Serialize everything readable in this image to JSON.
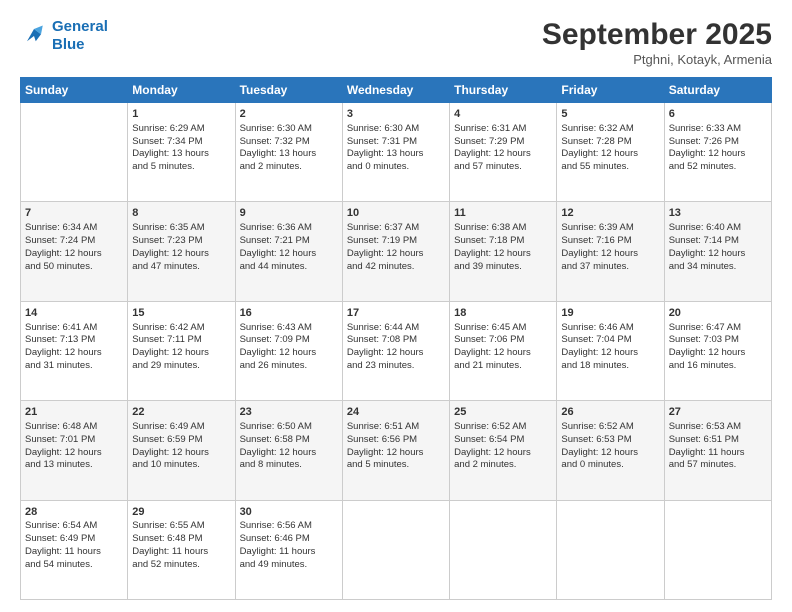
{
  "logo": {
    "line1": "General",
    "line2": "Blue"
  },
  "title": "September 2025",
  "subtitle": "Ptghni, Kotayk, Armenia",
  "headers": [
    "Sunday",
    "Monday",
    "Tuesday",
    "Wednesday",
    "Thursday",
    "Friday",
    "Saturday"
  ],
  "weeks": [
    [
      {
        "day": "",
        "info": ""
      },
      {
        "day": "1",
        "info": "Sunrise: 6:29 AM\nSunset: 7:34 PM\nDaylight: 13 hours\nand 5 minutes."
      },
      {
        "day": "2",
        "info": "Sunrise: 6:30 AM\nSunset: 7:32 PM\nDaylight: 13 hours\nand 2 minutes."
      },
      {
        "day": "3",
        "info": "Sunrise: 6:30 AM\nSunset: 7:31 PM\nDaylight: 13 hours\nand 0 minutes."
      },
      {
        "day": "4",
        "info": "Sunrise: 6:31 AM\nSunset: 7:29 PM\nDaylight: 12 hours\nand 57 minutes."
      },
      {
        "day": "5",
        "info": "Sunrise: 6:32 AM\nSunset: 7:28 PM\nDaylight: 12 hours\nand 55 minutes."
      },
      {
        "day": "6",
        "info": "Sunrise: 6:33 AM\nSunset: 7:26 PM\nDaylight: 12 hours\nand 52 minutes."
      }
    ],
    [
      {
        "day": "7",
        "info": "Sunrise: 6:34 AM\nSunset: 7:24 PM\nDaylight: 12 hours\nand 50 minutes."
      },
      {
        "day": "8",
        "info": "Sunrise: 6:35 AM\nSunset: 7:23 PM\nDaylight: 12 hours\nand 47 minutes."
      },
      {
        "day": "9",
        "info": "Sunrise: 6:36 AM\nSunset: 7:21 PM\nDaylight: 12 hours\nand 44 minutes."
      },
      {
        "day": "10",
        "info": "Sunrise: 6:37 AM\nSunset: 7:19 PM\nDaylight: 12 hours\nand 42 minutes."
      },
      {
        "day": "11",
        "info": "Sunrise: 6:38 AM\nSunset: 7:18 PM\nDaylight: 12 hours\nand 39 minutes."
      },
      {
        "day": "12",
        "info": "Sunrise: 6:39 AM\nSunset: 7:16 PM\nDaylight: 12 hours\nand 37 minutes."
      },
      {
        "day": "13",
        "info": "Sunrise: 6:40 AM\nSunset: 7:14 PM\nDaylight: 12 hours\nand 34 minutes."
      }
    ],
    [
      {
        "day": "14",
        "info": "Sunrise: 6:41 AM\nSunset: 7:13 PM\nDaylight: 12 hours\nand 31 minutes."
      },
      {
        "day": "15",
        "info": "Sunrise: 6:42 AM\nSunset: 7:11 PM\nDaylight: 12 hours\nand 29 minutes."
      },
      {
        "day": "16",
        "info": "Sunrise: 6:43 AM\nSunset: 7:09 PM\nDaylight: 12 hours\nand 26 minutes."
      },
      {
        "day": "17",
        "info": "Sunrise: 6:44 AM\nSunset: 7:08 PM\nDaylight: 12 hours\nand 23 minutes."
      },
      {
        "day": "18",
        "info": "Sunrise: 6:45 AM\nSunset: 7:06 PM\nDaylight: 12 hours\nand 21 minutes."
      },
      {
        "day": "19",
        "info": "Sunrise: 6:46 AM\nSunset: 7:04 PM\nDaylight: 12 hours\nand 18 minutes."
      },
      {
        "day": "20",
        "info": "Sunrise: 6:47 AM\nSunset: 7:03 PM\nDaylight: 12 hours\nand 16 minutes."
      }
    ],
    [
      {
        "day": "21",
        "info": "Sunrise: 6:48 AM\nSunset: 7:01 PM\nDaylight: 12 hours\nand 13 minutes."
      },
      {
        "day": "22",
        "info": "Sunrise: 6:49 AM\nSunset: 6:59 PM\nDaylight: 12 hours\nand 10 minutes."
      },
      {
        "day": "23",
        "info": "Sunrise: 6:50 AM\nSunset: 6:58 PM\nDaylight: 12 hours\nand 8 minutes."
      },
      {
        "day": "24",
        "info": "Sunrise: 6:51 AM\nSunset: 6:56 PM\nDaylight: 12 hours\nand 5 minutes."
      },
      {
        "day": "25",
        "info": "Sunrise: 6:52 AM\nSunset: 6:54 PM\nDaylight: 12 hours\nand 2 minutes."
      },
      {
        "day": "26",
        "info": "Sunrise: 6:52 AM\nSunset: 6:53 PM\nDaylight: 12 hours\nand 0 minutes."
      },
      {
        "day": "27",
        "info": "Sunrise: 6:53 AM\nSunset: 6:51 PM\nDaylight: 11 hours\nand 57 minutes."
      }
    ],
    [
      {
        "day": "28",
        "info": "Sunrise: 6:54 AM\nSunset: 6:49 PM\nDaylight: 11 hours\nand 54 minutes."
      },
      {
        "day": "29",
        "info": "Sunrise: 6:55 AM\nSunset: 6:48 PM\nDaylight: 11 hours\nand 52 minutes."
      },
      {
        "day": "30",
        "info": "Sunrise: 6:56 AM\nSunset: 6:46 PM\nDaylight: 11 hours\nand 49 minutes."
      },
      {
        "day": "",
        "info": ""
      },
      {
        "day": "",
        "info": ""
      },
      {
        "day": "",
        "info": ""
      },
      {
        "day": "",
        "info": ""
      }
    ]
  ]
}
